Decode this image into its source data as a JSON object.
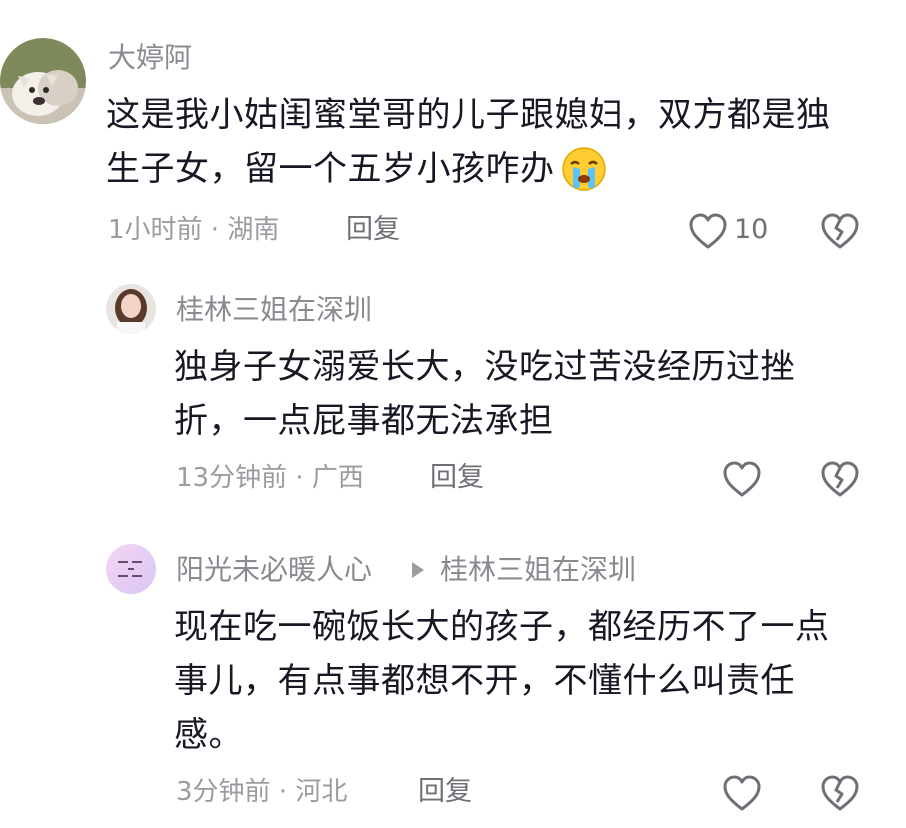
{
  "comments": [
    {
      "author": "大婷阿",
      "text_line1": "这是我小姑闺蜜堂哥的儿子跟媳妇，双方都是独",
      "text_line2": "生子女，留一个五岁小孩咋办",
      "emoji": "crying-face",
      "meta": "1小时前 · 湖南",
      "reply_label": "回复",
      "likes": "10"
    },
    {
      "author": "桂林三姐在深圳",
      "text_line1": "独身子女溺爱长大，没吃过苦没经历过挫",
      "text_line2": "折，一点屁事都无法承担",
      "meta": "13分钟前 · 广西",
      "reply_label": "回复"
    },
    {
      "author": "阳光未必暖人心",
      "reply_to": "桂林三姐在深圳",
      "text_line1": "现在吃一碗饭长大的孩子，都经历不了一点",
      "text_line2": "事儿，有点事都想不开，不懂什么叫责任",
      "text_line3": "感。",
      "meta": "3分钟前 · 河北",
      "reply_label": "回复"
    }
  ],
  "icons": {
    "like": "heart-outline-icon",
    "dislike": "broken-heart-icon",
    "reply_arrow": "play-triangle-icon"
  }
}
